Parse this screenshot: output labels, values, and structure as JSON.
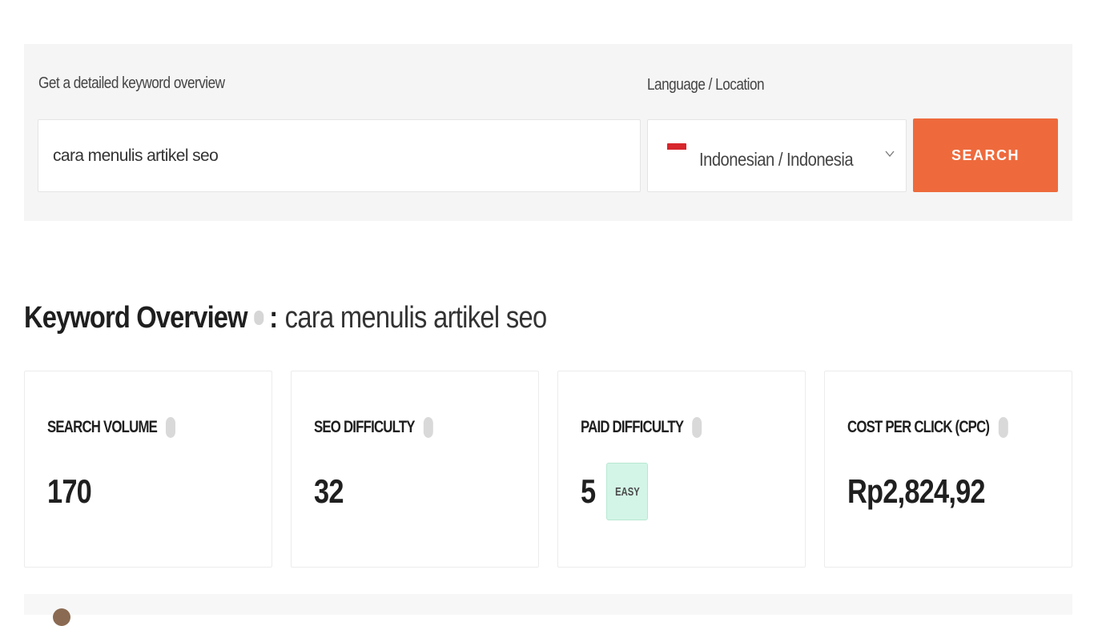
{
  "search": {
    "keyword_label": "Get a detailed keyword overview",
    "keyword_value": "cara menulis artikel seo",
    "language_label": "Language / Location",
    "language_value": "Indonesian / Indonesia",
    "flag_icon": "indonesia-flag-icon",
    "button_label": "SEARCH",
    "accent_color": "#ee6a3c"
  },
  "overview": {
    "title": "Keyword Overview",
    "separator": ":",
    "keyword": "cara menulis artikel seo"
  },
  "metrics": [
    {
      "label": "SEARCH VOLUME",
      "value": "170"
    },
    {
      "label": "SEO DIFFICULTY",
      "value": "32"
    },
    {
      "label": "PAID DIFFICULTY",
      "value": "5",
      "badge": "EASY",
      "badge_color": "#d3f5e7"
    },
    {
      "label": "COST PER CLICK (CPC)",
      "value": "Rp2,824,92"
    }
  ]
}
